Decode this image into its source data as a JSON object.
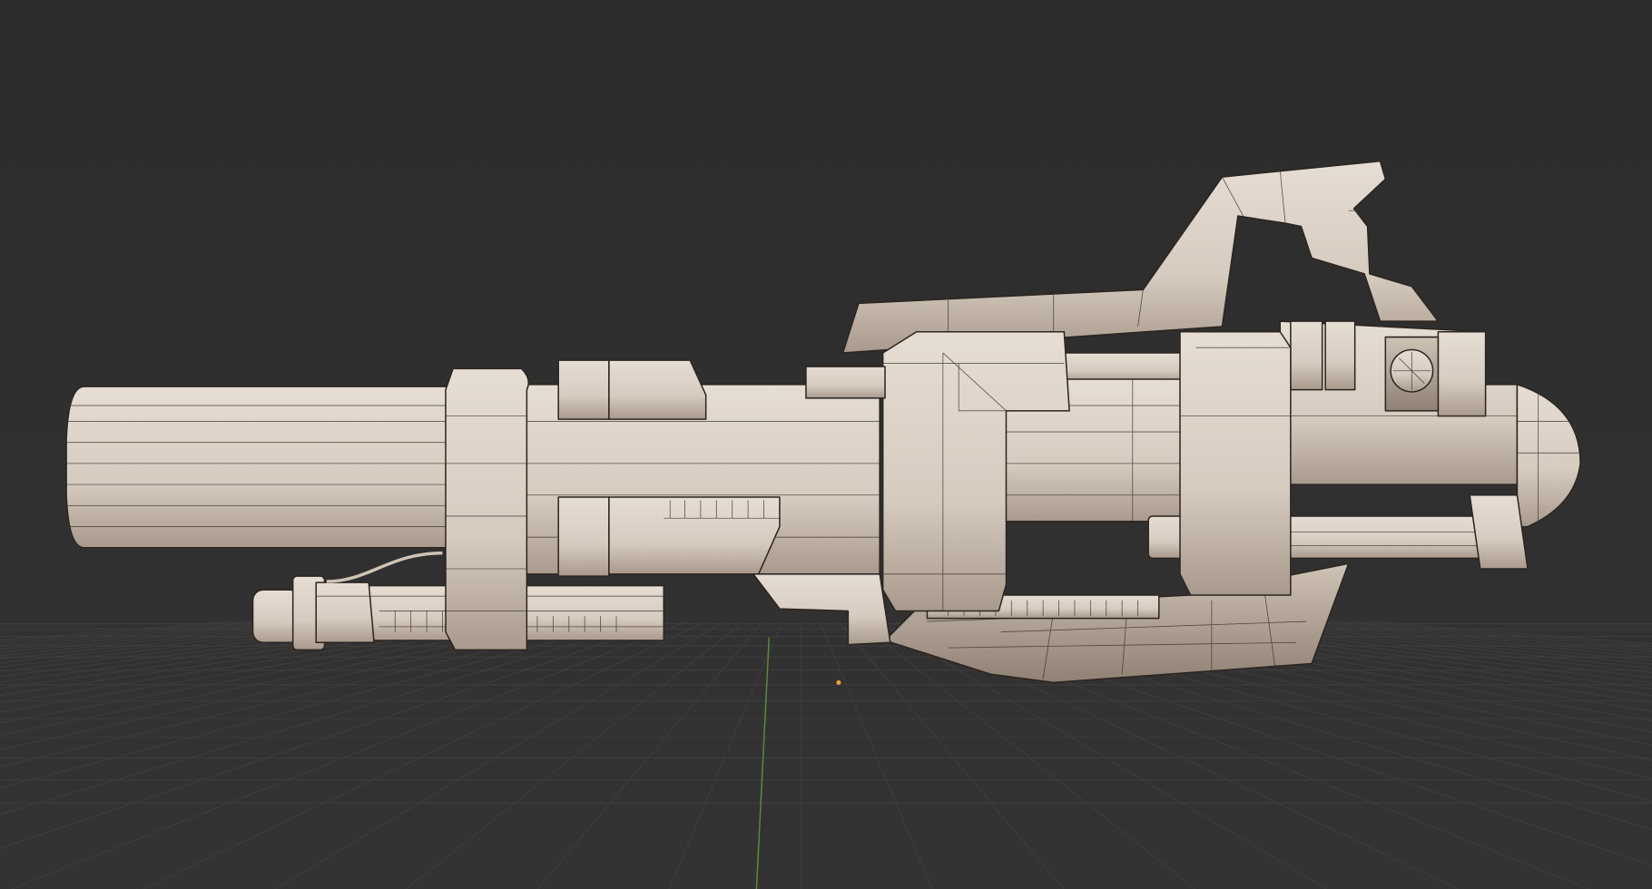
{
  "viewport": {
    "editor": "3D Viewport",
    "shading": "solid-wireframe",
    "colors": {
      "background": "#2d2d2d",
      "grid": "#3c3c3c",
      "y_axis": "#5a8a32",
      "material": "#d8cec3",
      "wire": "#2b2520",
      "origin": "#e8a030"
    }
  }
}
